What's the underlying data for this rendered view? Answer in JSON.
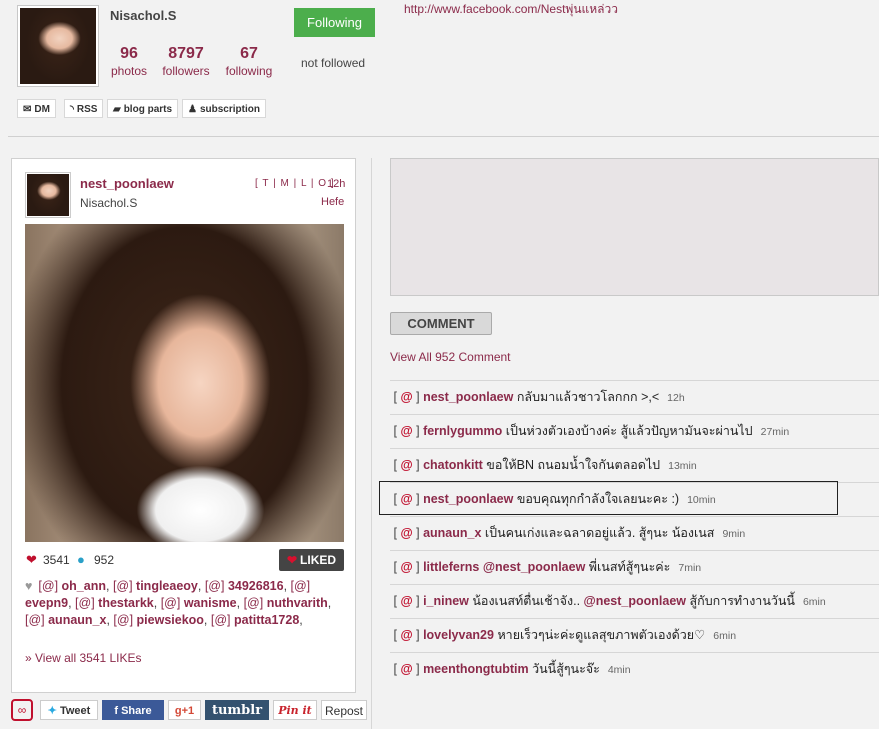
{
  "profile": {
    "display_name": "Nisachol.S",
    "photos_count": "96",
    "photos_label": "photos",
    "followers_count": "8797",
    "followers_label": "followers",
    "following_count": "67",
    "following_label": "following",
    "follow_button": "Following",
    "follow_status": "not followed",
    "facebook_link": "http://www.facebook.com/Nestพุ่นแหล่วว"
  },
  "toolbar": {
    "dm": "DM",
    "rss": "RSS",
    "blog_parts": "blog parts",
    "subscription": "subscription"
  },
  "post": {
    "username": "nest_poonlaew",
    "name": "Nisachol.S",
    "views": "[ T | M | L | O ]",
    "time": "12h",
    "filter": "Hefe",
    "likes_count": "3541",
    "comments_count": "952",
    "liked_button": "LIKED",
    "likers": [
      {
        "tag": "[@]",
        "name": "oh_ann"
      },
      {
        "tag": "[@]",
        "name": "tingleaeoy"
      },
      {
        "tag": "[@]",
        "name": "34926816"
      },
      {
        "tag": "[@]",
        "name": "evepn9"
      },
      {
        "tag": "[@]",
        "name": "thestarkk"
      },
      {
        "tag": "[@]",
        "name": "wanisme"
      },
      {
        "tag": "[@]",
        "name": "nuthvarith"
      },
      {
        "tag": "[@]",
        "name": "aunaun_x"
      },
      {
        "tag": "[@]",
        "name": "piewsiekoo"
      },
      {
        "tag": "[@]",
        "name": "patitta1728"
      }
    ],
    "view_all_likes": "» View all 3541 LIKEs"
  },
  "share": {
    "tweet": "Tweet",
    "facebook": "Share",
    "gplus": "+1",
    "tumblr": "tumblr",
    "pinterest": "Pin it",
    "repost": "Repost"
  },
  "comments_section": {
    "comment_button": "COMMENT",
    "view_all": "View All 952 Comment",
    "items": [
      {
        "user": "nest_poonlaew",
        "pre_mention": "",
        "mention": "",
        "text": "กลับมาแล้วชาวโลกกก >,<",
        "time": "12h"
      },
      {
        "user": "fernlygummo",
        "pre_mention": "",
        "mention": "",
        "text": "เป็นห่วงตัวเองบ้างค่ะ สู้แล้วปัญหามันจะผ่านไป",
        "time": "27min"
      },
      {
        "user": "chatonkitt",
        "pre_mention": "",
        "mention": "",
        "text": "ขอให้BN ถนอมน้ำใจกันตลอดไป",
        "time": "13min"
      },
      {
        "user": "nest_poonlaew",
        "pre_mention": "",
        "mention": "",
        "text": "ขอบคุณทุกกำลังใจเลยนะคะ :)",
        "time": "10min"
      },
      {
        "user": "aunaun_x",
        "pre_mention": "",
        "mention": "",
        "text": "เป็นคนเก่งและฉลาดอยู่แล้ว. สู้ๆนะ น้องเนส",
        "time": "9min"
      },
      {
        "user": "littleferns",
        "pre_mention": "",
        "mention": "@nest_poonlaew",
        "text": "พี่เนสท์สู้ๆนะค่ะ",
        "time": "7min"
      },
      {
        "user": "i_ninew",
        "pre_mention": "น้องเนสท์ตื่นเช้าจัง..",
        "mention": "@nest_poonlaew",
        "text": "สู้กับการทำงานวันนี้",
        "time": "6min"
      },
      {
        "user": "lovelyvan29",
        "pre_mention": "",
        "mention": "",
        "text": "หายเร็วๆน่ะค่ะดูแลสุขภาพตัวเองด้วย♡",
        "time": "6min"
      },
      {
        "user": "meenthongtubtim",
        "pre_mention": "",
        "mention": "",
        "text": "วันนี้สู้ๆนะจ๊ะ",
        "time": "4min"
      }
    ]
  }
}
